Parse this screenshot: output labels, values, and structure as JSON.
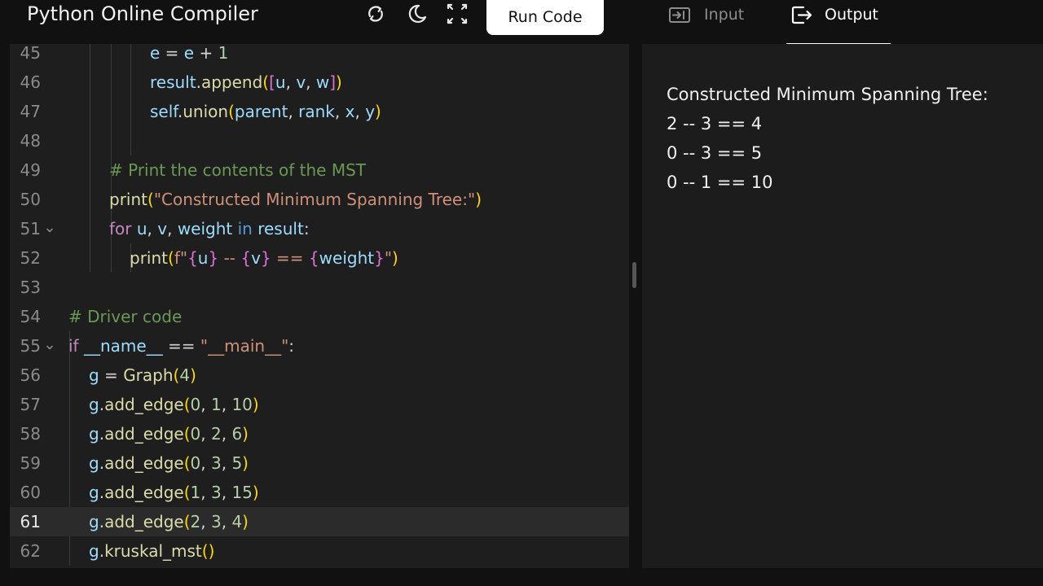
{
  "app": {
    "title": "Python Online Compiler"
  },
  "toolbar": {
    "run_label": "Run Code",
    "icons": [
      "refresh-icon",
      "moon-icon",
      "fullscreen-icon"
    ]
  },
  "tabs": [
    {
      "label": "Input",
      "icon": "input-icon",
      "active": false
    },
    {
      "label": "Output",
      "icon": "output-icon",
      "active": true
    }
  ],
  "editor": {
    "active_line": 61,
    "lines": [
      {
        "num": "45",
        "fold": false,
        "indent": 4,
        "tokens": [
          [
            "e",
            "var"
          ],
          [
            " = ",
            "op"
          ],
          [
            "e",
            "var"
          ],
          [
            " + ",
            "op"
          ],
          [
            "1",
            "num"
          ]
        ]
      },
      {
        "num": "46",
        "fold": false,
        "indent": 4,
        "tokens": [
          [
            "result",
            "var"
          ],
          [
            ".",
            "op"
          ],
          [
            "append",
            "func"
          ],
          [
            "(",
            "brace"
          ],
          [
            "[",
            "brace2"
          ],
          [
            "u",
            "var"
          ],
          [
            ", ",
            "op"
          ],
          [
            "v",
            "var"
          ],
          [
            ", ",
            "op"
          ],
          [
            "w",
            "var"
          ],
          [
            "]",
            "brace2"
          ],
          [
            ")",
            "brace"
          ]
        ]
      },
      {
        "num": "47",
        "fold": false,
        "indent": 4,
        "tokens": [
          [
            "self",
            "var"
          ],
          [
            ".",
            "op"
          ],
          [
            "union",
            "func"
          ],
          [
            "(",
            "brace"
          ],
          [
            "parent",
            "var"
          ],
          [
            ", ",
            "op"
          ],
          [
            "rank",
            "var"
          ],
          [
            ", ",
            "op"
          ],
          [
            "x",
            "var"
          ],
          [
            ", ",
            "op"
          ],
          [
            "y",
            "var"
          ],
          [
            ")",
            "brace"
          ]
        ]
      },
      {
        "num": "48",
        "fold": false,
        "indent": 0,
        "tokens": []
      },
      {
        "num": "49",
        "fold": false,
        "indent": 2,
        "tokens": [
          [
            "# Print the contents of the MST",
            "comment"
          ]
        ]
      },
      {
        "num": "50",
        "fold": false,
        "indent": 2,
        "tokens": [
          [
            "print",
            "func"
          ],
          [
            "(",
            "brace"
          ],
          [
            "\"Constructed Minimum Spanning Tree:\"",
            "str"
          ],
          [
            ")",
            "brace"
          ]
        ]
      },
      {
        "num": "51",
        "fold": true,
        "indent": 2,
        "tokens": [
          [
            "for",
            "kw"
          ],
          [
            " ",
            "op"
          ],
          [
            "u",
            "var"
          ],
          [
            ", ",
            "op"
          ],
          [
            "v",
            "var"
          ],
          [
            ", ",
            "op"
          ],
          [
            "weight",
            "var"
          ],
          [
            " ",
            "op"
          ],
          [
            "in",
            "ctrl"
          ],
          [
            " ",
            "op"
          ],
          [
            "result",
            "var"
          ],
          [
            ":",
            "op"
          ]
        ]
      },
      {
        "num": "52",
        "fold": false,
        "indent": 3,
        "tokens": [
          [
            "print",
            "func"
          ],
          [
            "(",
            "brace"
          ],
          [
            "f\"",
            "str"
          ],
          [
            "{",
            "brace2"
          ],
          [
            "u",
            "var"
          ],
          [
            "}",
            "brace2"
          ],
          [
            " -- ",
            "str"
          ],
          [
            "{",
            "brace2"
          ],
          [
            "v",
            "var"
          ],
          [
            "}",
            "brace2"
          ],
          [
            " == ",
            "str"
          ],
          [
            "{",
            "brace2"
          ],
          [
            "weight",
            "var"
          ],
          [
            "}",
            "brace2"
          ],
          [
            "\"",
            "str"
          ],
          [
            ")",
            "brace"
          ]
        ]
      },
      {
        "num": "53",
        "fold": false,
        "indent": 0,
        "tokens": []
      },
      {
        "num": "54",
        "fold": false,
        "indent": 0,
        "tokens": [
          [
            "# Driver code",
            "comment"
          ]
        ]
      },
      {
        "num": "55",
        "fold": true,
        "indent": 0,
        "tokens": [
          [
            "if",
            "kw"
          ],
          [
            " ",
            "op"
          ],
          [
            "__name__",
            "var"
          ],
          [
            " == ",
            "op"
          ],
          [
            "\"__main__\"",
            "str"
          ],
          [
            ":",
            "op"
          ]
        ]
      },
      {
        "num": "56",
        "fold": false,
        "indent": 1,
        "tokens": [
          [
            "g",
            "var"
          ],
          [
            " = ",
            "op"
          ],
          [
            "Graph",
            "func"
          ],
          [
            "(",
            "brace"
          ],
          [
            "4",
            "num"
          ],
          [
            ")",
            "brace"
          ]
        ]
      },
      {
        "num": "57",
        "fold": false,
        "indent": 1,
        "tokens": [
          [
            "g",
            "var"
          ],
          [
            ".",
            "op"
          ],
          [
            "add_edge",
            "func"
          ],
          [
            "(",
            "brace"
          ],
          [
            "0",
            "num"
          ],
          [
            ", ",
            "op"
          ],
          [
            "1",
            "num"
          ],
          [
            ", ",
            "op"
          ],
          [
            "10",
            "num"
          ],
          [
            ")",
            "brace"
          ]
        ]
      },
      {
        "num": "58",
        "fold": false,
        "indent": 1,
        "tokens": [
          [
            "g",
            "var"
          ],
          [
            ".",
            "op"
          ],
          [
            "add_edge",
            "func"
          ],
          [
            "(",
            "brace"
          ],
          [
            "0",
            "num"
          ],
          [
            ", ",
            "op"
          ],
          [
            "2",
            "num"
          ],
          [
            ", ",
            "op"
          ],
          [
            "6",
            "num"
          ],
          [
            ")",
            "brace"
          ]
        ]
      },
      {
        "num": "59",
        "fold": false,
        "indent": 1,
        "tokens": [
          [
            "g",
            "var"
          ],
          [
            ".",
            "op"
          ],
          [
            "add_edge",
            "func"
          ],
          [
            "(",
            "brace"
          ],
          [
            "0",
            "num"
          ],
          [
            ", ",
            "op"
          ],
          [
            "3",
            "num"
          ],
          [
            ", ",
            "op"
          ],
          [
            "5",
            "num"
          ],
          [
            ")",
            "brace"
          ]
        ]
      },
      {
        "num": "60",
        "fold": false,
        "indent": 1,
        "tokens": [
          [
            "g",
            "var"
          ],
          [
            ".",
            "op"
          ],
          [
            "add_edge",
            "func"
          ],
          [
            "(",
            "brace"
          ],
          [
            "1",
            "num"
          ],
          [
            ", ",
            "op"
          ],
          [
            "3",
            "num"
          ],
          [
            ", ",
            "op"
          ],
          [
            "15",
            "num"
          ],
          [
            ")",
            "brace"
          ]
        ]
      },
      {
        "num": "61",
        "fold": false,
        "indent": 1,
        "tokens": [
          [
            "g",
            "var"
          ],
          [
            ".",
            "op"
          ],
          [
            "add_edge",
            "func"
          ],
          [
            "(",
            "brace"
          ],
          [
            "2",
            "num"
          ],
          [
            ", ",
            "op"
          ],
          [
            "3",
            "num"
          ],
          [
            ", ",
            "op"
          ],
          [
            "4",
            "num"
          ],
          [
            ")",
            "brace"
          ]
        ]
      },
      {
        "num": "62",
        "fold": false,
        "indent": 1,
        "tokens": [
          [
            "g",
            "var"
          ],
          [
            ".",
            "op"
          ],
          [
            "kruskal_mst",
            "func"
          ],
          [
            "(",
            "brace"
          ],
          [
            ")",
            "brace"
          ]
        ]
      }
    ]
  },
  "output": {
    "lines": [
      "Constructed Minimum Spanning Tree:",
      "2 -- 3 == 4",
      "0 -- 3 == 5",
      "0 -- 1 == 10"
    ]
  },
  "colors": {
    "background": "#111111",
    "editor_bg": "#1e1e1e",
    "output_bg": "#1c1c1c",
    "run_button_bg": "#ffffff"
  }
}
